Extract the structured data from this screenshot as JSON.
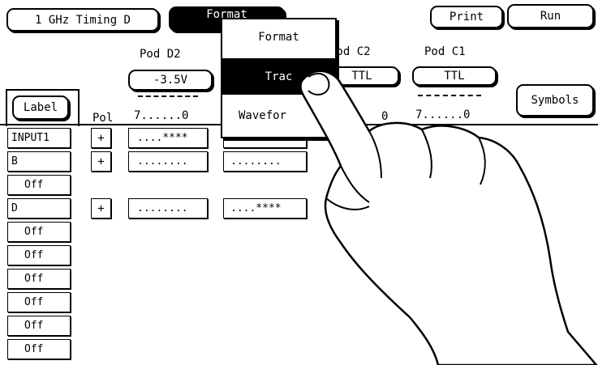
{
  "top": {
    "timing_label": "1 GHz Timing D",
    "format_label": "Format",
    "print_label": "Print",
    "run_label": "Run"
  },
  "pods": [
    {
      "name": "Pod D2",
      "threshold": "-3.5V",
      "bits": "7......0"
    },
    {
      "name": "Pod C2",
      "threshold": "TTL",
      "bits": "0"
    },
    {
      "name": "Pod C1",
      "threshold": "TTL",
      "bits": "7......0"
    }
  ],
  "headers": {
    "label_button": "Label",
    "pol": "Pol",
    "symbols_button": "Symbols"
  },
  "rows": [
    {
      "label": "INPUT1",
      "pol": "+",
      "d2": "....****",
      "c2": "........"
    },
    {
      "label": "B",
      "pol": "+",
      "d2": "........",
      "c2": "........"
    },
    {
      "label": "Off",
      "pol": "",
      "d2": "",
      "c2": ""
    },
    {
      "label": "D",
      "pol": "+",
      "d2": "........",
      "c2": "....****"
    },
    {
      "label": "Off",
      "pol": "",
      "d2": "",
      "c2": ""
    },
    {
      "label": "Off",
      "pol": "",
      "d2": "",
      "c2": ""
    },
    {
      "label": "Off",
      "pol": "",
      "d2": "",
      "c2": ""
    },
    {
      "label": "Off",
      "pol": "",
      "d2": "",
      "c2": ""
    },
    {
      "label": "Off",
      "pol": "",
      "d2": "",
      "c2": ""
    },
    {
      "label": "Off",
      "pol": "",
      "d2": "",
      "c2": ""
    }
  ],
  "menu": {
    "items": [
      "Format",
      "Trac",
      "Wavefor"
    ],
    "selected_index": 1
  }
}
